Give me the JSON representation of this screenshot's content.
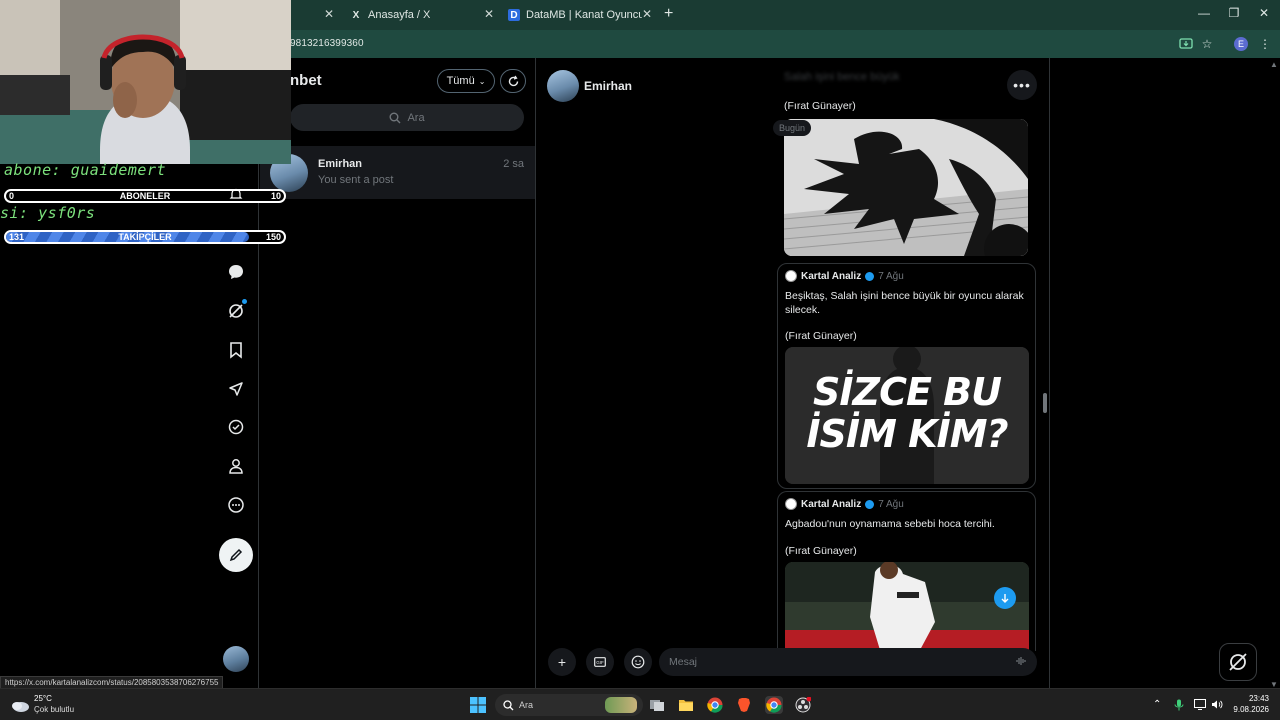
{
  "browser": {
    "tabs": [
      {
        "title": "Anasayfa / X",
        "favicon": "X"
      },
      {
        "title": "DataMB | Kanat Oyuncularını Ka",
        "favicon": "D"
      }
    ],
    "url": "9813216399360"
  },
  "messages": {
    "header": "nbet",
    "filter_label": "Tümü",
    "search_placeholder": "Ara",
    "conversation": {
      "name": "Emirhan",
      "time": "2 sa",
      "preview": "You sent a post"
    }
  },
  "chat": {
    "name": "Emirhan",
    "blurred_line": "Salah işini bence büyük",
    "date_pill": "Bugün",
    "posts": [
      {
        "author": "Kartal Analiz",
        "date": "7 Ağu",
        "text": "Beşiktaş, Salah işini bence büyük bir oyuncu alarak silecek.",
        "credit": "(Fırat Günayer)",
        "image_text_1": "SİZCE BU",
        "image_text_2": "İSİM KİM?"
      },
      {
        "author": "Kartal Analiz",
        "date": "7 Ağu",
        "text": "Agbadou'nun oynamama sebebi hoca tercihi.",
        "credit": "(Fırat Günayer)"
      }
    ],
    "top_credit": "(Fırat Günayer)",
    "composer_placeholder": "Mesaj"
  },
  "overlay": {
    "line1": "abone: guaidemert",
    "line2": "si: ysf0rs",
    "subs": {
      "label": "ABONELER",
      "current": "0",
      "goal": "10",
      "progress": 0
    },
    "followers": {
      "label": "TAKİPÇİLER",
      "current": "131",
      "goal": "150",
      "progress": 0.873
    }
  },
  "status_url": "https://x.com/kartalanalizcom/status/2085803538706276755",
  "taskbar": {
    "temperature": "25°C",
    "weather": "Çok bulutlu",
    "search": "Ara",
    "time": "23:43",
    "date": "9.08.2026"
  },
  "colors": {
    "accent": "#1d9bf0",
    "overlay_text": "#7ce07c",
    "chrome": "#1a3b33"
  }
}
